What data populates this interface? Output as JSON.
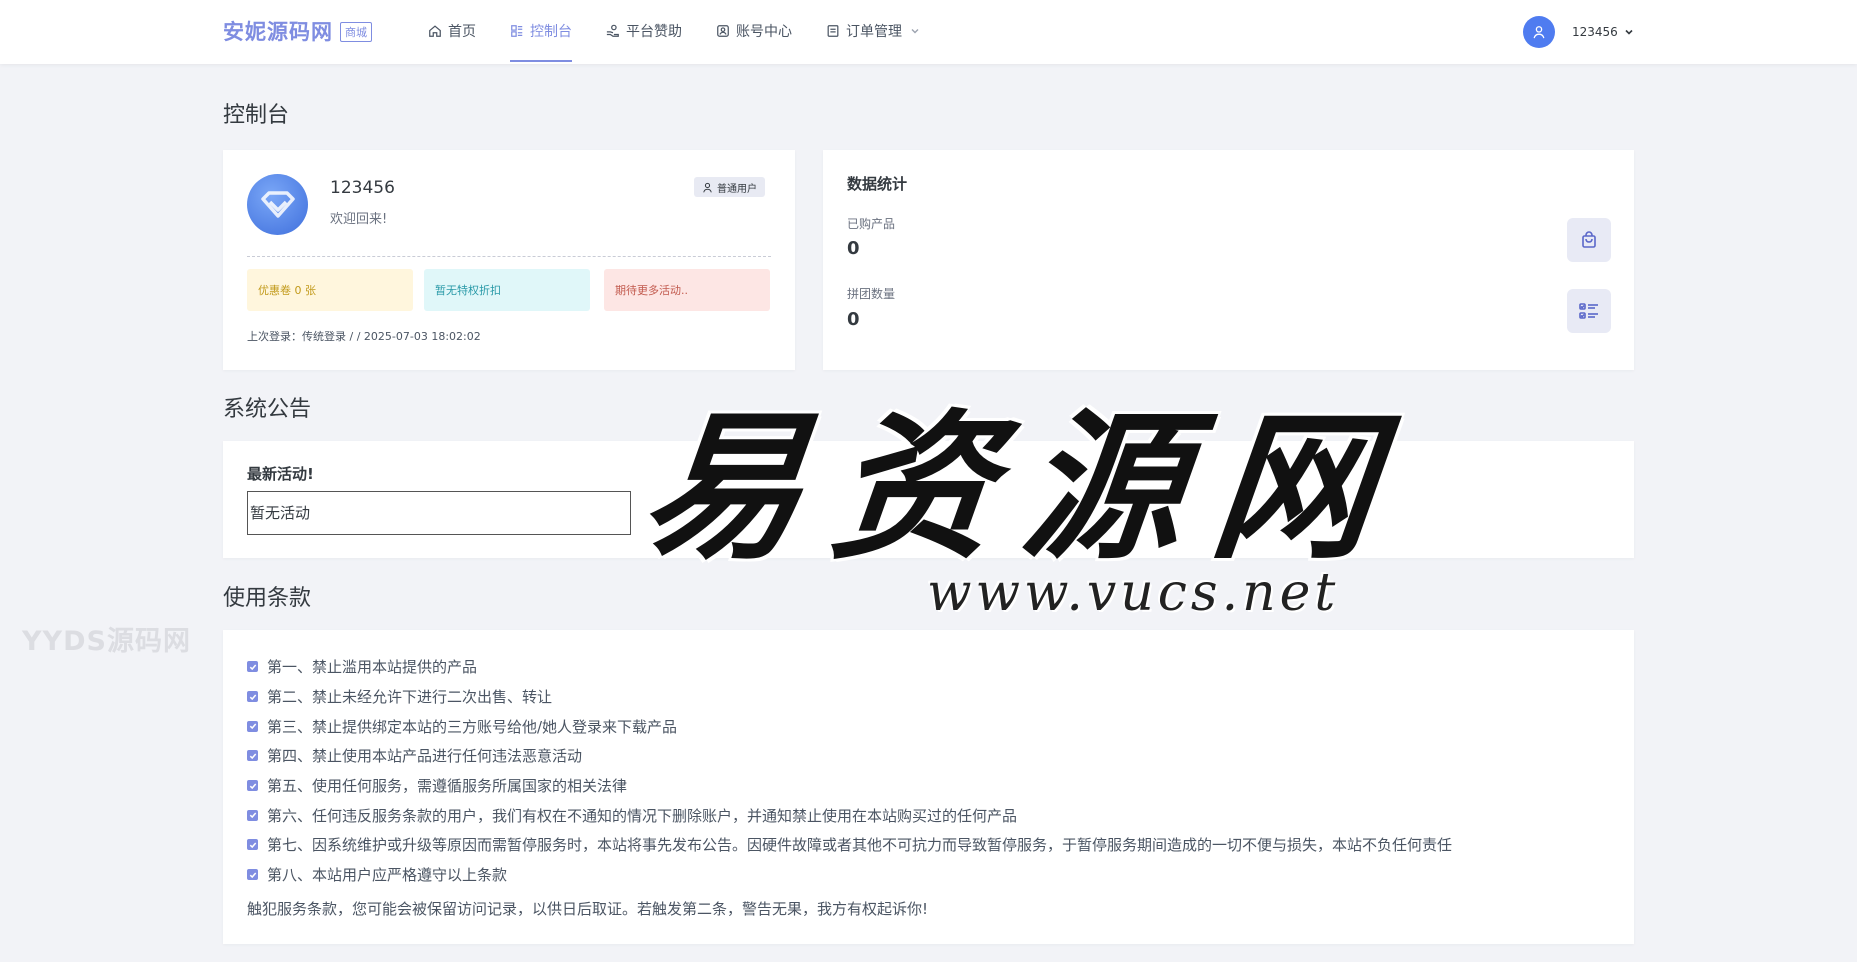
{
  "header": {
    "brand": "安妮源码网",
    "brand_badge": "商城",
    "nav": [
      {
        "label": "首页",
        "icon": "home-icon",
        "active": false
      },
      {
        "label": "控制台",
        "icon": "dashboard-icon",
        "active": true
      },
      {
        "label": "平台赞助",
        "icon": "donate-icon",
        "active": false
      },
      {
        "label": "账号中心",
        "icon": "account-icon",
        "active": false
      },
      {
        "label": "订单管理",
        "icon": "orders-icon",
        "active": false,
        "dropdown": true
      }
    ],
    "username": "123456"
  },
  "page_title": "控制台",
  "profile": {
    "name": "123456",
    "welcome": "欢迎回来!",
    "user_type": "普通用户",
    "chips": {
      "coupon": "优惠卷 0 张",
      "discount": "暂无特权折扣",
      "activity": "期待更多活动.."
    },
    "last_login": "上次登录：传统登录 / / 2025-07-03 18:02:02"
  },
  "stats": {
    "title": "数据统计",
    "purchased_label": "已购产品",
    "purchased_value": "0",
    "group_label": "拼团数量",
    "group_value": "0"
  },
  "announcement": {
    "section_title": "系统公告",
    "heading": "最新活动!",
    "content": "暂无活动"
  },
  "terms": {
    "section_title": "使用条款",
    "items": [
      "第一、禁止滥用本站提供的产品",
      "第二、禁止未经允许下进行二次出售、转让",
      "第三、禁止提供绑定本站的三方账号给他/她人登录来下载产品",
      "第四、禁止使用本站产品进行任何违法恶意活动",
      "第五、使用任何服务，需遵循服务所属国家的相关法律",
      "第六、任何违反服务条款的用户，我们有权在不通知的情况下删除账户，并通知禁止使用在本站购买过的任何产品",
      "第七、因系统维护或升级等原因而需暂停服务时，本站将事先发布公告。因硬件故障或者其他不可抗力而导致暂停服务，于暂停服务期间造成的一切不便与损失，本站不负任何责任",
      "第八、本站用户应严格遵守以上条款"
    ],
    "footer": "触犯服务条款，您可能会被保留访问记录，以供日后取证。若触发第二条，警告无果，我方有权起诉你!"
  },
  "watermarks": {
    "left": "YYDS源码网",
    "main": "易资源网",
    "url": "www.vucs.net"
  },
  "colors": {
    "accent": "#7f8de1",
    "background": "#f2f3f7",
    "avatar_blue": "#4f7cf0"
  }
}
